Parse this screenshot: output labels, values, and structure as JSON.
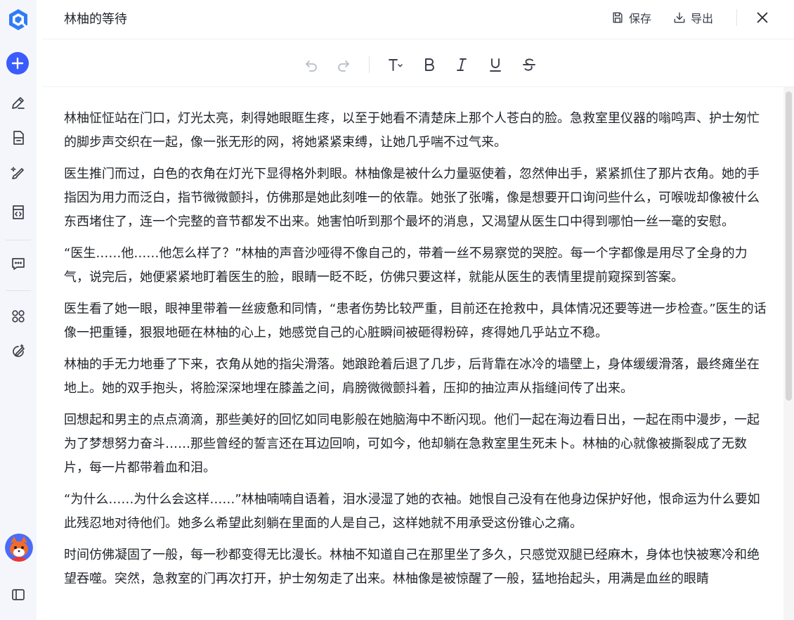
{
  "document": {
    "title": "林柚的等待"
  },
  "header": {
    "save_label": "保存",
    "export_label": "导出"
  },
  "content": {
    "paragraphs": [
      "林柚怔怔站在门口，灯光太亮，刺得她眼眶生疼，以至于她看不清楚床上那个人苍白的脸。急救室里仪器的嗡鸣声、护士匆忙的脚步声交织在一起，像一张无形的网，将她紧紧束缚，让她几乎喘不过气来。",
      "医生推门而过，白色的衣角在灯光下显得格外刺眼。林柚像是被什么力量驱使着，忽然伸出手，紧紧抓住了那片衣角。她的手指因为用力而泛白，指节微微颤抖，仿佛那是她此刻唯一的依靠。她张了张嘴，像是想要开口询问些什么，可喉咙却像被什么东西堵住了，连一个完整的音节都发不出来。她害怕听到那个最坏的消息，又渴望从医生口中得到哪怕一丝一毫的安慰。",
      "“医生……他……他怎么样了？”林柚的声音沙哑得不像自己的，带着一丝不易察觉的哭腔。每一个字都像是用尽了全身的力气，说完后，她便紧紧地盯着医生的脸，眼睛一眨不眨，仿佛只要这样，就能从医生的表情里提前窥探到答案。",
      "医生看了她一眼，眼神里带着一丝疲惫和同情，“患者伤势比较严重，目前还在抢救中，具体情况还要等进一步检查。”医生的话像一把重锤，狠狠地砸在林柚的心上，她感觉自己的心脏瞬间被砸得粉碎，疼得她几乎站立不稳。",
      "林柚的手无力地垂了下来，衣角从她的指尖滑落。她踉跄着后退了几步，后背靠在冰冷的墙壁上，身体缓缓滑落，最终瘫坐在地上。她的双手抱头，将脸深深地埋在膝盖之间，肩膀微微颤抖着，压抑的抽泣声从指缝间传了出来。",
      "回想起和男主的点点滴滴，那些美好的回忆如同电影般在她脑海中不断闪现。他们一起在海边看日出，一起在雨中漫步，一起为了梦想努力奋斗……那些曾经的誓言还在耳边回响，可如今，他却躺在急救室里生死未卜。林柚的心就像被撕裂成了无数片，每一片都带着血和泪。",
      "“为什么……为什么会这样……”林柚喃喃自语着，泪水浸湿了她的衣袖。她恨自己没有在他身边保护好他，恨命运为什么要如此残忍地对待他们。她多么希望此刻躺在里面的人是自己，这样她就不用承受这份锥心之痛。",
      "时间仿佛凝固了一般，每一秒都变得无比漫长。林柚不知道自己在那里坐了多久，只感觉双腿已经麻木，身体也快被寒冷和绝望吞噬。突然，急救室的门再次打开，护士匆匆走了出来。林柚像是被惊醒了一般，猛地抬起头，用满是血丝的眼睛"
    ]
  },
  "colors": {
    "accent": "#3b5bfd",
    "text": "#1f2329",
    "icon": "#3a3f4b",
    "disabled_icon": "#b8bcc6",
    "rail_bg": "#f4f6fb"
  },
  "icons": {
    "rail": [
      "app-logo-icon",
      "add-icon",
      "pen-icon",
      "document-icon",
      "brush-icon",
      "code-file-icon",
      "chat-icon",
      "apps-grid-icon",
      "magic-edit-icon",
      "avatar",
      "sidebar-toggle-icon"
    ],
    "toolbar": [
      "undo-icon",
      "redo-icon",
      "text-size-icon",
      "bold-icon",
      "italic-icon",
      "underline-icon",
      "strikethrough-icon"
    ]
  },
  "scroll": {
    "thumb_fraction": 0.58,
    "position_fraction": 0.0
  }
}
